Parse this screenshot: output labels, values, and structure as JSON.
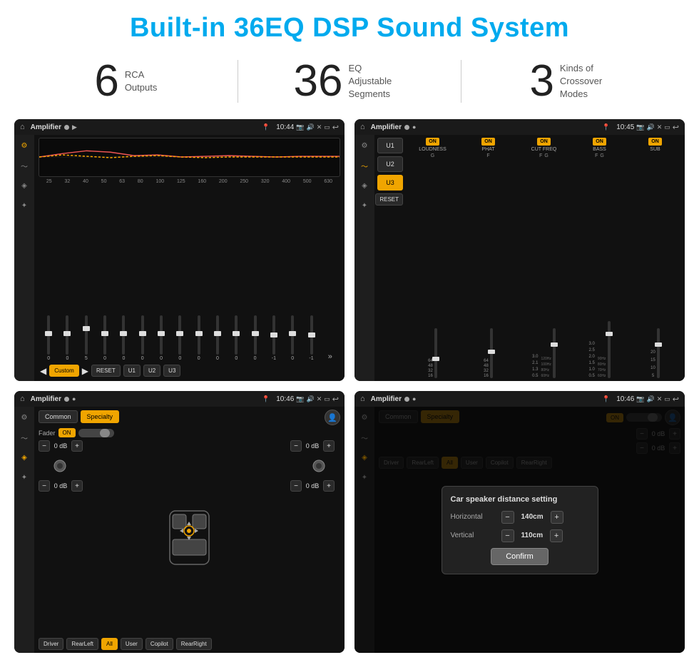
{
  "page": {
    "title": "Built-in 36EQ DSP Sound System",
    "stats": [
      {
        "number": "6",
        "desc_line1": "RCA",
        "desc_line2": "Outputs"
      },
      {
        "number": "36",
        "desc_line1": "EQ Adjustable",
        "desc_line2": "Segments"
      },
      {
        "number": "3",
        "desc_line1": "Kinds of",
        "desc_line2": "Crossover Modes"
      }
    ]
  },
  "screens": {
    "screen1": {
      "app_name": "Amplifier",
      "time": "10:44",
      "freq_labels": [
        "25",
        "32",
        "40",
        "50",
        "63",
        "80",
        "100",
        "125",
        "160",
        "200",
        "250",
        "320",
        "400",
        "500",
        "630"
      ],
      "slider_vals": [
        "0",
        "0",
        "0",
        "5",
        "0",
        "0",
        "0",
        "0",
        "0",
        "0",
        "0",
        "0",
        "0",
        "-1",
        "0",
        "-1"
      ],
      "buttons": [
        "Custom",
        "RESET",
        "U1",
        "U2",
        "U3"
      ]
    },
    "screen2": {
      "app_name": "Amplifier",
      "time": "10:45",
      "channels": [
        "U1",
        "U2",
        "U3"
      ],
      "mix_channels": [
        "LOUDNESS",
        "PHAT",
        "CUT FREQ",
        "BASS",
        "SUB"
      ],
      "reset_label": "RESET"
    },
    "screen3": {
      "app_name": "Amplifier",
      "time": "10:46",
      "tabs": [
        "Common",
        "Specialty"
      ],
      "fader_label": "Fader",
      "fader_on": "ON",
      "vol_labels": [
        "0 dB",
        "0 dB",
        "0 dB",
        "0 dB"
      ],
      "bottom_btns": [
        "Driver",
        "RearLeft",
        "All",
        "User",
        "Copilot",
        "RearRight"
      ]
    },
    "screen4": {
      "app_name": "Amplifier",
      "time": "10:46",
      "tabs": [
        "Common",
        "Specialty"
      ],
      "fader_on": "ON",
      "dialog": {
        "title": "Car speaker distance setting",
        "horizontal_label": "Horizontal",
        "horizontal_val": "140cm",
        "vertical_label": "Vertical",
        "vertical_val": "110cm",
        "confirm_label": "Confirm"
      },
      "vol_right_top": "0 dB",
      "vol_right_bottom": "0 dB",
      "bottom_btns": [
        "Driver",
        "RearLeft",
        "All",
        "User",
        "Copilot",
        "RearRight"
      ]
    }
  }
}
